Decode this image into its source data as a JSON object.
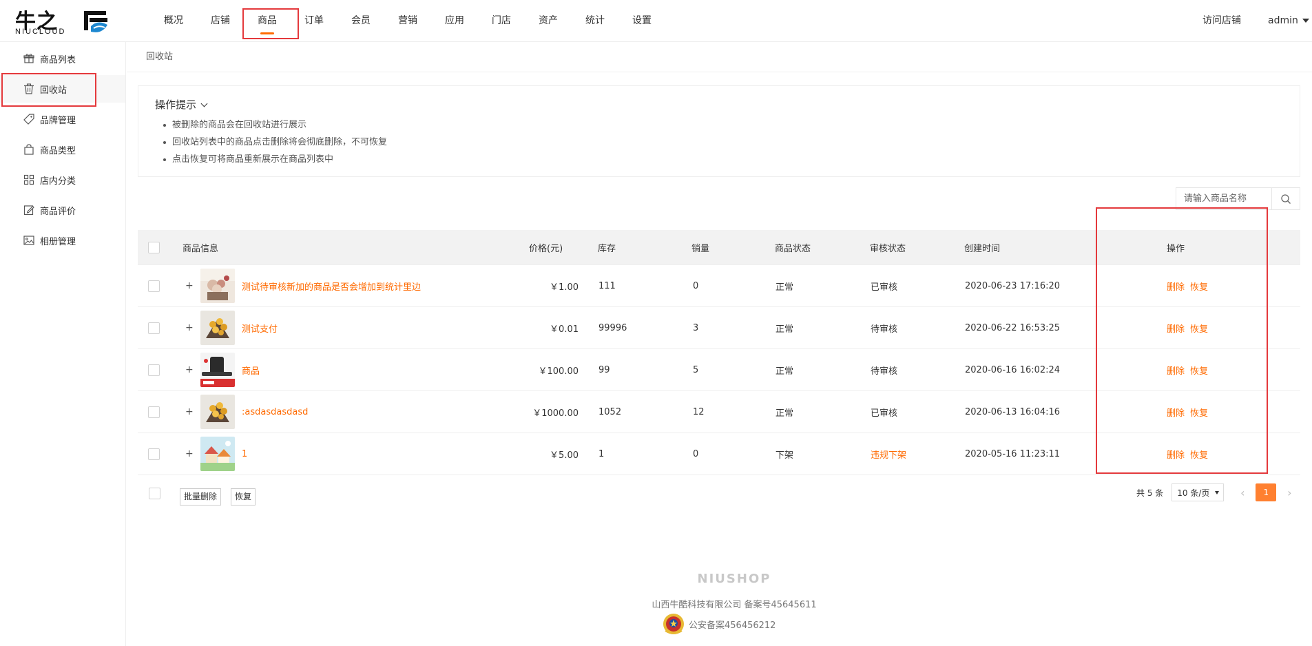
{
  "header": {
    "logo_cn": "牛之",
    "logo_en": "NIUCLOUD",
    "nav": [
      "概况",
      "店铺",
      "商品",
      "订单",
      "会员",
      "营销",
      "应用",
      "门店",
      "资产",
      "统计",
      "设置"
    ],
    "active_nav": "商品",
    "visit_store": "访问店铺",
    "user": "admin"
  },
  "sidebar": {
    "items": [
      {
        "label": "商品列表",
        "icon": "gift-icon"
      },
      {
        "label": "回收站",
        "icon": "trash-icon"
      },
      {
        "label": "品牌管理",
        "icon": "tag-icon"
      },
      {
        "label": "商品类型",
        "icon": "bag-icon"
      },
      {
        "label": "店内分类",
        "icon": "grid-icon"
      },
      {
        "label": "商品评价",
        "icon": "edit-icon"
      },
      {
        "label": "相册管理",
        "icon": "image-icon"
      }
    ],
    "active": "回收站"
  },
  "breadcrumb": "回收站",
  "tips": {
    "title": "操作提示",
    "items": [
      "被删除的商品会在回收站进行展示",
      "回收站列表中的商品点击删除将会彻底删除，不可恢复",
      "点击恢复可将商品重新展示在商品列表中"
    ]
  },
  "search": {
    "placeholder": "请输入商品名称"
  },
  "table": {
    "columns": [
      "商品信息",
      "价格(元)",
      "库存",
      "销量",
      "商品状态",
      "审核状态",
      "创建时间",
      "操作"
    ],
    "rows": [
      {
        "name": "测试待审核新加的商品是否会增加到统计里边",
        "price": "￥1.00",
        "stock": "111",
        "sales": "0",
        "status": "正常",
        "audit": "已审核",
        "created": "2020-06-23 17:16:20",
        "thumb": "flower-bouquet"
      },
      {
        "name": "测试支付",
        "price": "￥0.01",
        "stock": "99996",
        "sales": "3",
        "status": "正常",
        "audit": "待审核",
        "created": "2020-06-22 16:53:25",
        "thumb": "gold-bouquet"
      },
      {
        "name": "商品",
        "price": "￥100.00",
        "stock": "99",
        "sales": "5",
        "status": "正常",
        "audit": "待审核",
        "created": "2020-06-16 16:02:24",
        "thumb": "speaker"
      },
      {
        "name": ":asdasdasdasd",
        "price": "￥1000.00",
        "stock": "1052",
        "sales": "12",
        "status": "正常",
        "audit": "已审核",
        "created": "2020-06-13 16:04:16",
        "thumb": "gold-bouquet"
      },
      {
        "name": "1",
        "price": "￥5.00",
        "stock": "1",
        "sales": "0",
        "status": "下架",
        "audit": "违规下架",
        "created": "2020-05-16 11:23:11",
        "thumb": "cartoon-house"
      }
    ],
    "row_actions": {
      "delete": "删除",
      "restore": "恢复"
    },
    "expand_symbol": "+"
  },
  "bulk": {
    "delete_label": "批量删除",
    "restore_label": "恢复"
  },
  "pagination": {
    "total": "共 5 条",
    "page_size": "10 条/页",
    "current_page": "1"
  },
  "footer": {
    "brand": "NIUSHOP",
    "company": "山西牛酷科技有限公司  备案号45645611",
    "police": "公安备案456456212"
  },
  "colors": {
    "accent": "#ff6a00",
    "highlight_box": "#e4393c",
    "page_active": "#ff8030"
  }
}
